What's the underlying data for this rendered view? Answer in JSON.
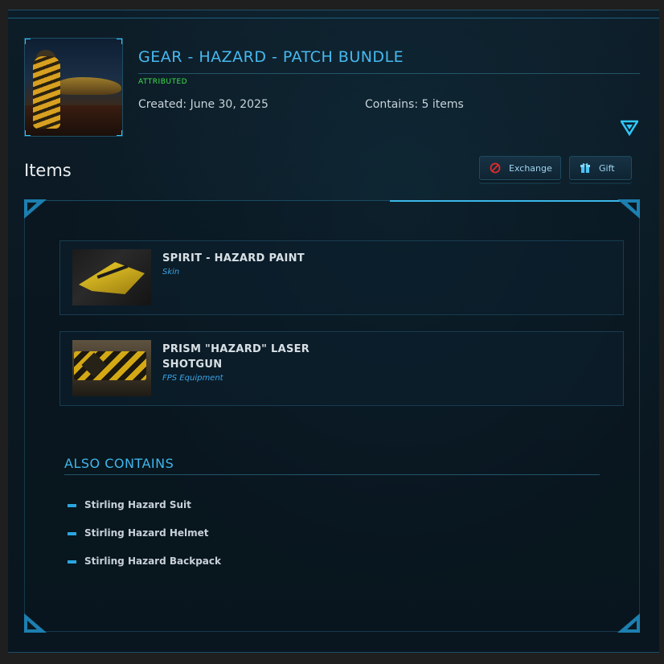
{
  "bundle": {
    "title": "GEAR - HAZARD - PATCH BUNDLE",
    "status": "ATTRIBUTED",
    "created": "Created: June 30, 2025",
    "contains": "Contains: 5 items"
  },
  "items_section": {
    "heading": "Items",
    "buttons": {
      "exchange": "Exchange",
      "gift": "Gift"
    },
    "items": [
      {
        "name": "SPIRIT - HAZARD PAINT",
        "type": "Skin"
      },
      {
        "name": "PRISM \"HAZARD\" LASER SHOTGUN",
        "type": "FPS Equipment"
      }
    ]
  },
  "also_contains": {
    "heading": "ALSO CONTAINS",
    "items": [
      "Stirling Hazard Suit",
      "Stirling Hazard Helmet",
      "Stirling Hazard Backpack"
    ]
  },
  "colors": {
    "accent": "#46b9f0",
    "attributed": "#3ee04b",
    "exchange_icon": "#e02a2a"
  },
  "icons": {
    "expand": "triangle-down-icon",
    "exchange": "no-entry-icon",
    "gift": "gift-box-icon"
  }
}
